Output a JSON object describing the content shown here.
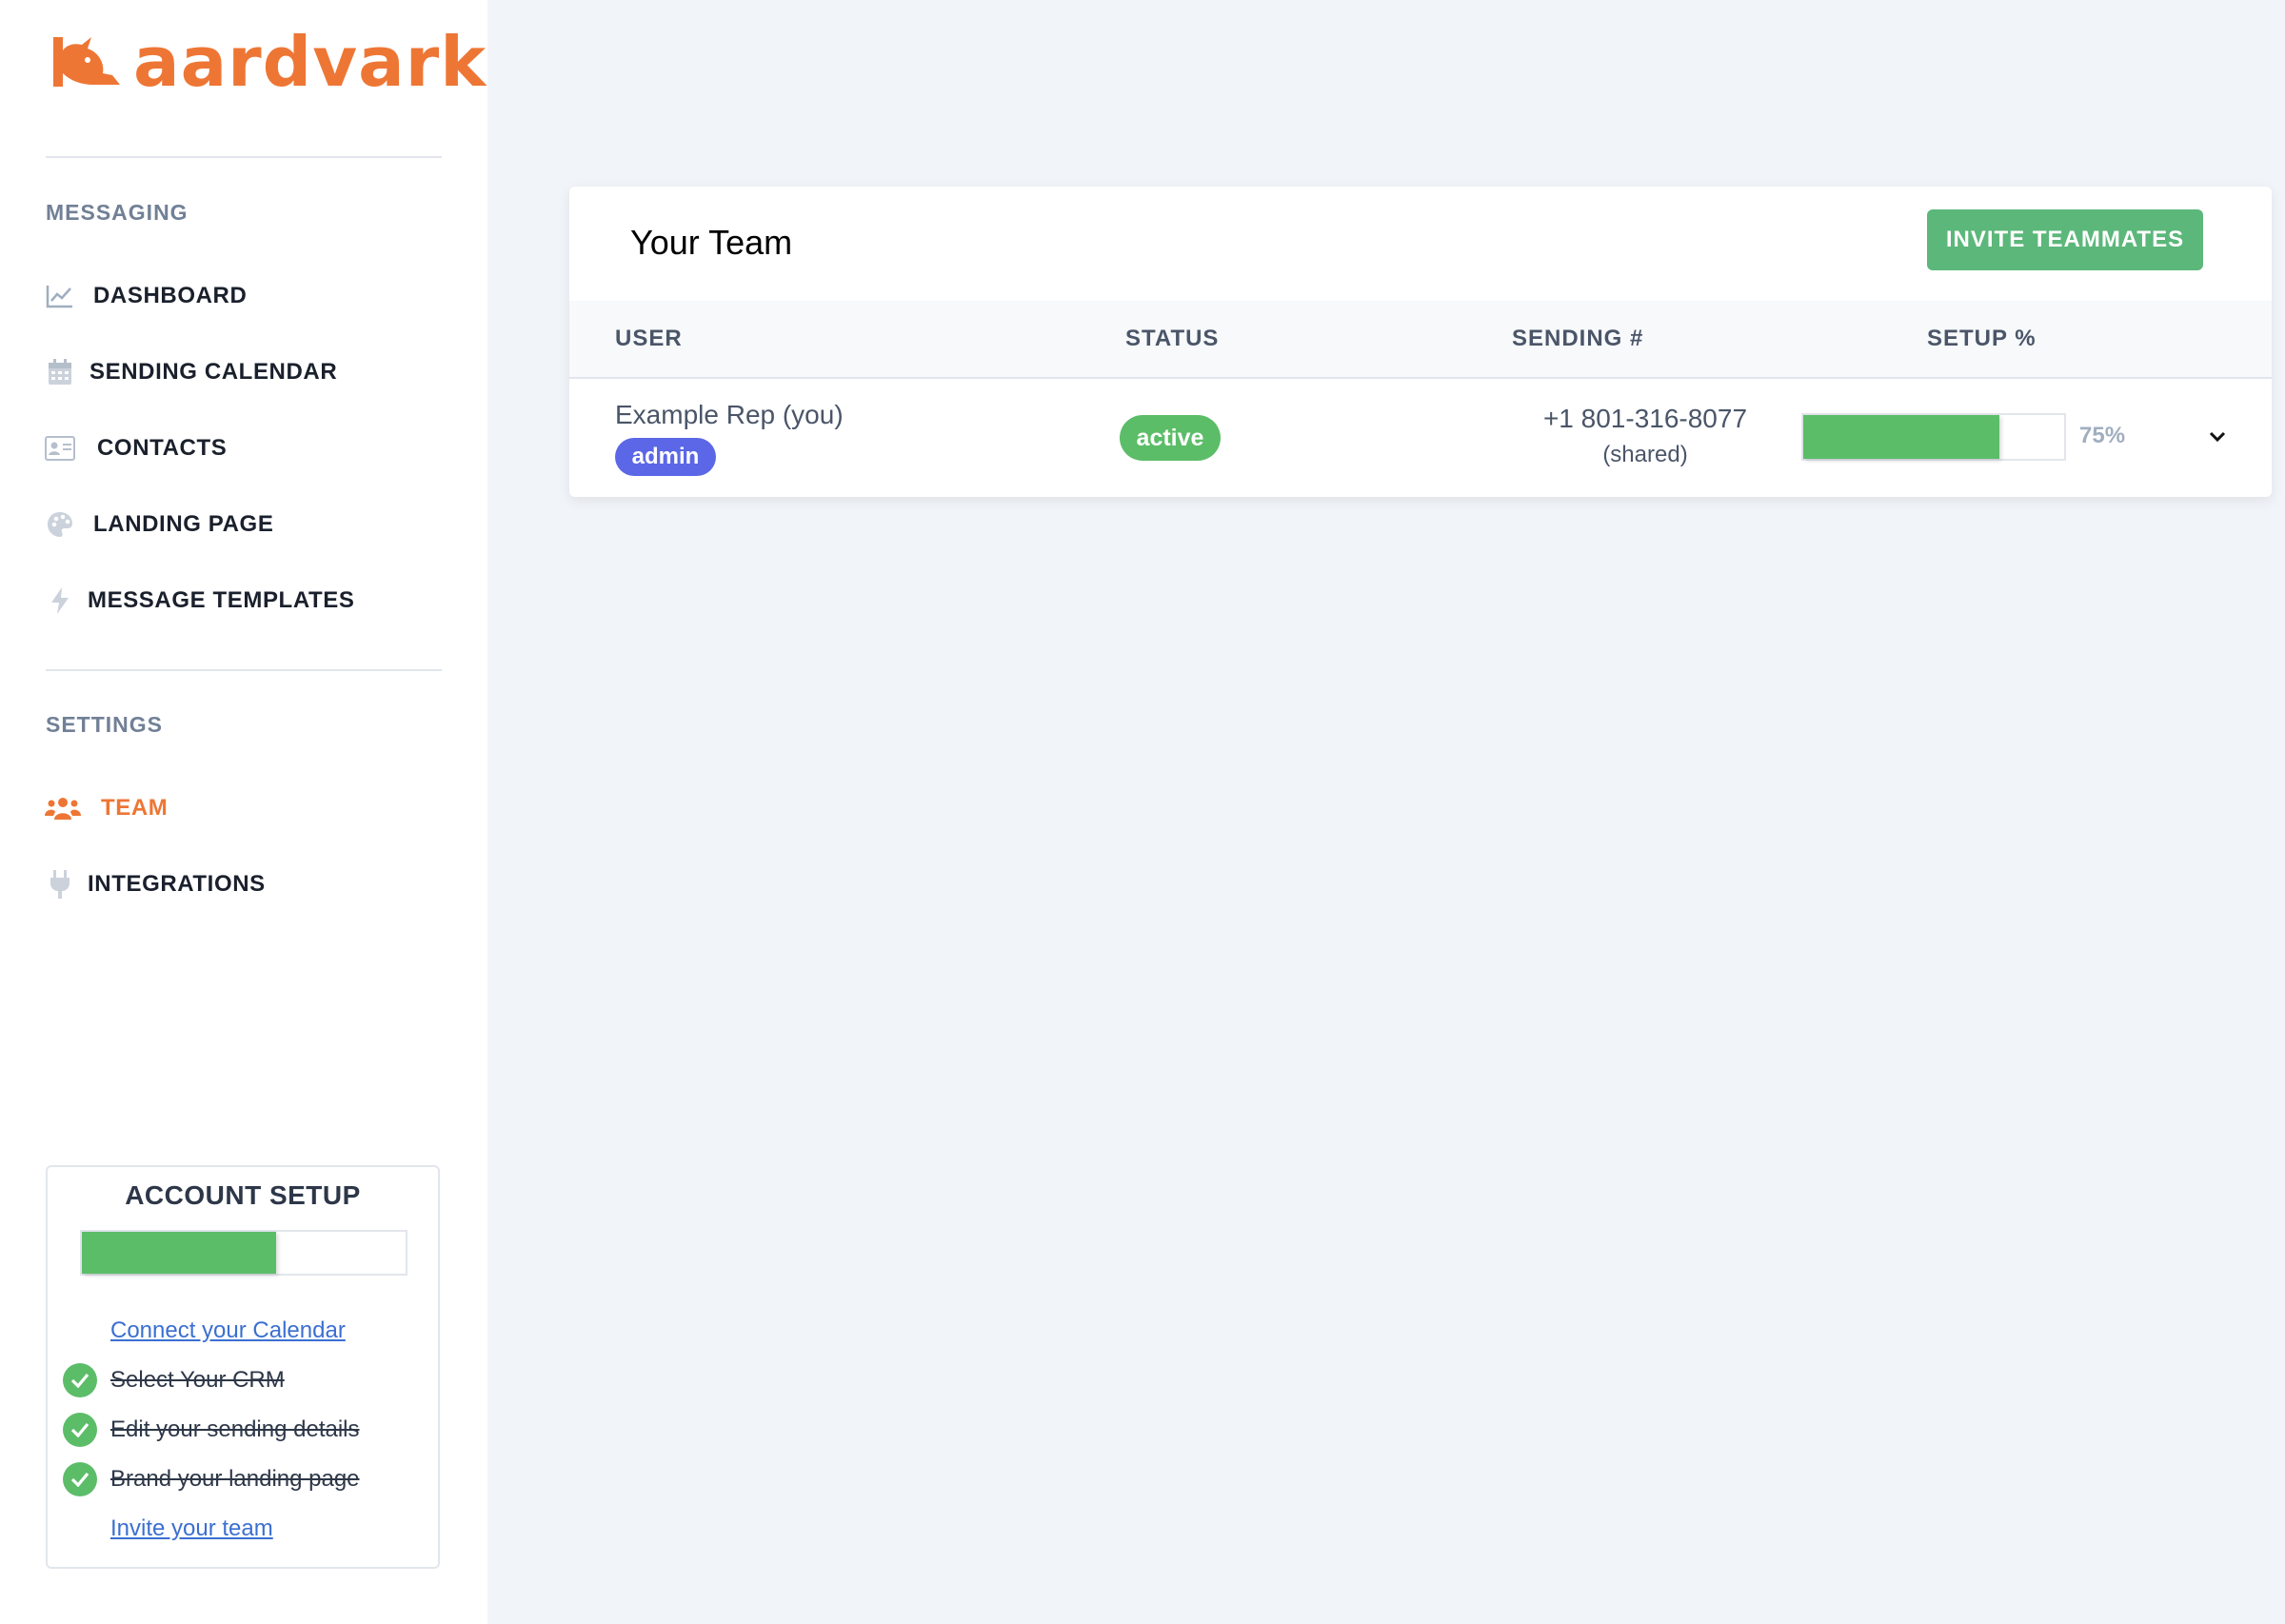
{
  "brand": {
    "name": "aardvark",
    "color": "#ee7635"
  },
  "sidebar": {
    "messaging_heading": "MESSAGING",
    "messaging_items": [
      {
        "label": "DASHBOARD",
        "icon": "chart-line-icon"
      },
      {
        "label": "SENDING CALENDAR",
        "icon": "calendar-icon"
      },
      {
        "label": "CONTACTS",
        "icon": "id-card-icon"
      },
      {
        "label": "LANDING PAGE",
        "icon": "palette-icon"
      },
      {
        "label": "MESSAGE TEMPLATES",
        "icon": "bolt-icon"
      }
    ],
    "settings_heading": "SETTINGS",
    "settings_items": [
      {
        "label": "TEAM",
        "icon": "users-icon",
        "active": true
      },
      {
        "label": "INTEGRATIONS",
        "icon": "plug-icon"
      }
    ]
  },
  "account_setup": {
    "title": "ACCOUNT SETUP",
    "progress": 0.6,
    "tasks": [
      {
        "label": "Connect your Calendar",
        "done": false
      },
      {
        "label": "Select Your CRM",
        "done": true
      },
      {
        "label": "Edit your sending details",
        "done": true
      },
      {
        "label": "Brand your landing page",
        "done": true
      },
      {
        "label": "Invite your team",
        "done": false
      }
    ]
  },
  "team": {
    "title": "Your Team",
    "invite_label": "INVITE TEAMMATES",
    "columns": [
      "USER",
      "STATUS",
      "SENDING #",
      "SETUP %"
    ],
    "rows": [
      {
        "user": "Example Rep (you)",
        "role": "admin",
        "status": "active",
        "sending_number": "+1 801-316-8077",
        "sending_note": "(shared)",
        "setup_pct_label": "75%",
        "setup_progress": 0.75
      }
    ]
  },
  "colors": {
    "green": "#5cbd68",
    "button_green": "#5cb77a",
    "admin_purple": "#5b67e6",
    "link_blue": "#3b6fd1"
  }
}
